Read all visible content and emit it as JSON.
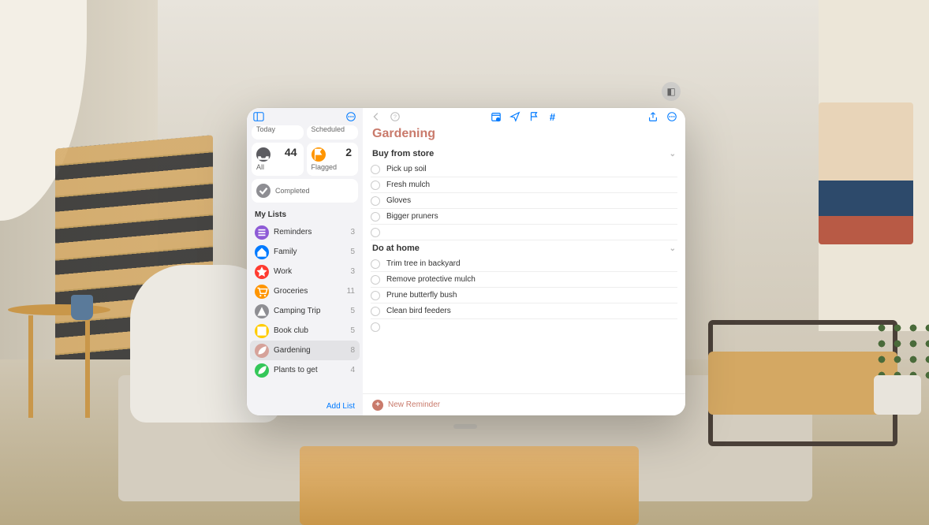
{
  "smart": {
    "today": {
      "label": "Today",
      "count": ""
    },
    "scheduled": {
      "label": "Scheduled",
      "count": ""
    },
    "all": {
      "label": "All",
      "count": "44"
    },
    "flagged": {
      "label": "Flagged",
      "count": "2"
    },
    "completed": {
      "label": "Completed",
      "count": ""
    }
  },
  "lists_header": "My Lists",
  "lists": [
    {
      "name": "Reminders",
      "count": "3",
      "color": "#8e5bd6",
      "icon": "list"
    },
    {
      "name": "Family",
      "count": "5",
      "color": "#007aff",
      "icon": "house"
    },
    {
      "name": "Work",
      "count": "3",
      "color": "#ff3b30",
      "icon": "star"
    },
    {
      "name": "Groceries",
      "count": "11",
      "color": "#ff9500",
      "icon": "cart"
    },
    {
      "name": "Camping Trip",
      "count": "5",
      "color": "#8e8e93",
      "icon": "tent"
    },
    {
      "name": "Book club",
      "count": "5",
      "color": "#ffcc00",
      "icon": "book"
    },
    {
      "name": "Gardening",
      "count": "8",
      "color": "#d6a29a",
      "icon": "leaf",
      "selected": true
    },
    {
      "name": "Plants to get",
      "count": "4",
      "color": "#34c759",
      "icon": "leaf"
    }
  ],
  "add_list": "Add List",
  "title": "Gardening",
  "groups": [
    {
      "name": "Buy from store",
      "tasks": [
        "Pick up soil",
        "Fresh mulch",
        "Gloves",
        "Bigger pruners",
        ""
      ]
    },
    {
      "name": "Do at home",
      "tasks": [
        "Trim tree in backyard",
        "Remove protective mulch",
        "Prune butterfly bush",
        "Clean bird feeders",
        ""
      ]
    }
  ],
  "new_reminder": "New Reminder",
  "colors": {
    "accent": "#007aff",
    "title": "#c97a6b",
    "today": "#007aff",
    "scheduled": "#ff3b30",
    "all": "#5b5b60",
    "flagged": "#ff9500",
    "completed": "#8e8e93"
  }
}
